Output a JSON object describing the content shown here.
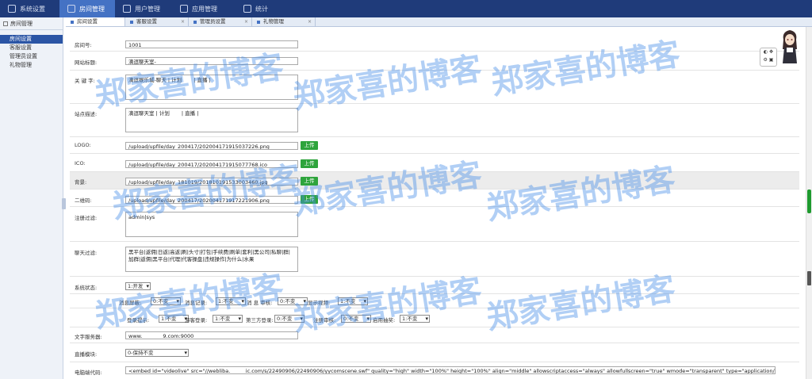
{
  "topnav": {
    "items": [
      {
        "label": "系统设置",
        "icon": "gear-icon",
        "active": false
      },
      {
        "label": "房间管理",
        "icon": "home-icon",
        "active": true
      },
      {
        "label": "用户管理",
        "icon": "user-icon",
        "active": false
      },
      {
        "label": "应用管理",
        "icon": "app-icon",
        "active": false
      },
      {
        "label": "统计",
        "icon": "chart-icon",
        "active": false
      }
    ]
  },
  "sidebar": {
    "group": "房间管理",
    "items": [
      {
        "label": "房间设置",
        "active": true
      },
      {
        "label": "客服设置",
        "active": false
      },
      {
        "label": "管理员设置",
        "active": false
      },
      {
        "label": "礼物管理",
        "active": false
      }
    ]
  },
  "tabs": [
    {
      "label": "房间设置",
      "active": true
    },
    {
      "label": "客服设置",
      "active": false
    },
    {
      "label": "管理员设置",
      "active": false
    },
    {
      "label": "礼物管理",
      "active": false
    }
  ],
  "form": {
    "room_no": {
      "label": "房间号:",
      "value": "1001"
    },
    "site_title": {
      "label": "网站标题:",
      "value": "滴逗聊天室-"
    },
    "keywords": {
      "label": "关 键 字:",
      "value": "滴逗娱乐城-聊天 | 计划 　　| 直播 |"
    },
    "description": {
      "label": "站点描述:",
      "value": "滴逗聊天室 | 计划 　　| 直播 |"
    },
    "logo": {
      "label": "LOGO:",
      "value": "/upload/upfile/day_200417/202004171915037226.png",
      "button": "上传"
    },
    "ico": {
      "label": "ICO:",
      "value": "/upload/upfile/day_200417/202004171915077768.ico",
      "button": "上传"
    },
    "background": {
      "label": "背景:",
      "value": "/upload/upfile/day_181019/201810191533003460.jpg",
      "button": "上传"
    },
    "qrcode": {
      "label": "二维码:",
      "value": "/upload/upfile/day_200417/202004171917221906.png",
      "button": "上传"
    },
    "register_filter": {
      "label": "注册过滤:",
      "value": "admin|sys"
    },
    "chat_filter": {
      "label": "聊天过滤:",
      "value": "黑平台|返佣|日返|高返|刷|头寸|打包|手续费|刷单|套利|黑公司|私聊|群|加群|返佣|黑平台|代理|代客操盘|违规操作|为什么|水果"
    },
    "system_status": {
      "label": "系统状态:",
      "value": "1:开发"
    },
    "options_row1": [
      {
        "label": "消息屏蔽:",
        "value": "0:不变"
      },
      {
        "label": "消息记录:",
        "value": "1:不变"
      },
      {
        "label": "消 息 审核:",
        "value": "0:不变"
      },
      {
        "label": "显示视频:",
        "value": "1:不变"
      }
    ],
    "options_row2": [
      {
        "label": "登录提示:",
        "value": "1:不变"
      },
      {
        "label": "游客登录:",
        "value": "1:不变"
      },
      {
        "label": "第三方登录:",
        "value": "0:不变"
      },
      {
        "label": "注册审核:",
        "value": "0:不变"
      },
      {
        "label": "启用抽奖:",
        "value": "1:不变"
      }
    ],
    "text_server": {
      "label": "文字服务器:",
      "value": "www.　　　　9.com:9000"
    },
    "live_module": {
      "label": "直播模块:",
      "value": "0-保持不变"
    },
    "pc_code": {
      "label": "电脑端代码:",
      "value": "<embed id=\"videolive\" src=\"//webliba.　　　ic.com/s/22490906/22490906/yycomscene.swf\" quality=\"high\" width=\"100%\" height=\"100%\" align=\"middle\" allowscriptaccess=\"always\" allowfullscreen=\"true\" wmode=\"transparent\" type=\"application/x-shockwave-flash\" autostart=\"true\">"
    }
  },
  "widget": {
    "line1": "◐ ✥",
    "line2": "⚙ ▣"
  },
  "watermark": "郑家喜的博客"
}
